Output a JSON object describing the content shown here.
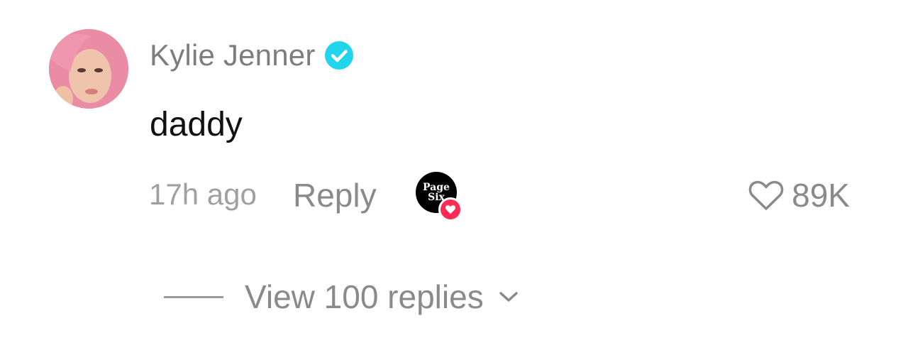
{
  "comment": {
    "username": "Kylie Jenner",
    "verified": true,
    "text": "daddy",
    "timestamp": "17h ago",
    "reply_label": "Reply",
    "liked_by_creator": {
      "logo_line1": "Page",
      "logo_line2": "Six"
    },
    "like_count": "89K",
    "view_replies_label": "View 100 replies"
  },
  "colors": {
    "verified_badge": "#20d5ec",
    "creator_heart": "#fe2c55",
    "muted_text": "#8a8a8a",
    "primary_text": "#111111"
  },
  "icons": {
    "verified": "verified-check-icon",
    "like": "heart-outline-icon",
    "creator_like": "heart-filled-icon",
    "expand": "chevron-down-icon"
  }
}
